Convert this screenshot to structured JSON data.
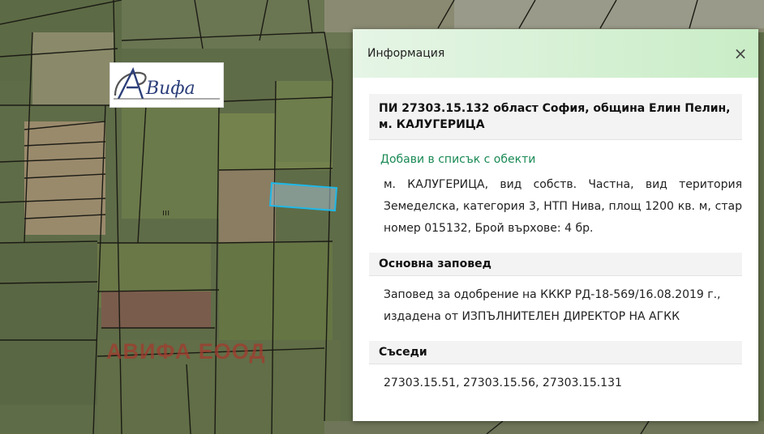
{
  "logo": {
    "text": "АВифа"
  },
  "watermark": {
    "text": "АВИФА ЕООД"
  },
  "colors": {
    "highlight": "#1fb8e8",
    "accent": "#1a8a55",
    "header_from": "#e6f5e6",
    "header_to": "#c9edc6"
  },
  "panel": {
    "header_title": "Информация",
    "close_icon": "×",
    "title": "ПИ 27303.15.132 област София, община Елин Пелин, м. КАЛУГЕРИЦА",
    "add_link": "Добави в списък с обекти",
    "description": "м. КАЛУГЕРИЦА, вид собств. Частна, вид територия Земеделска, категория 3, НТП Нива, площ 1200 кв. м, стар номер 015132, Брой върхове: 4 бр.",
    "order_heading": "Основна заповед",
    "order_text": "Заповед за одобрение на КККР РД-18-569/16.08.2019 г., издадена от ИЗПЪЛНИТЕЛЕН ДИРЕКТОР НА АГКК",
    "neighbors_heading": "Съседи",
    "neighbors_text": "27303.15.51, 27303.15.56, 27303.15.131"
  }
}
